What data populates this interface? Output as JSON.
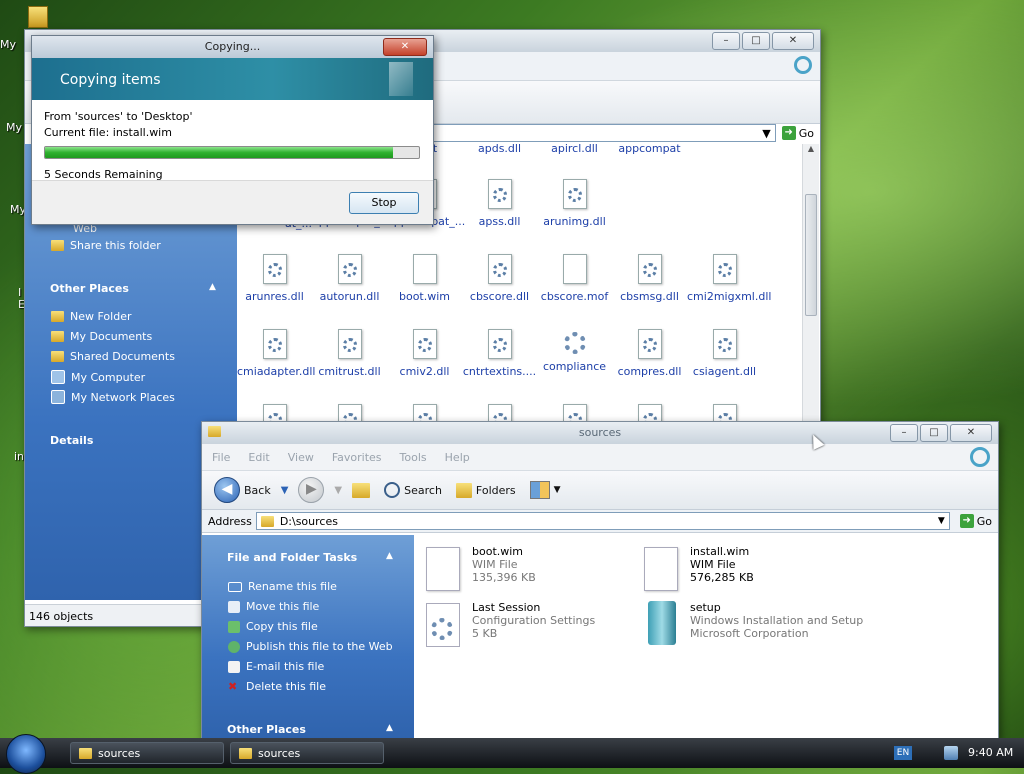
{
  "desktop": {
    "labels": [
      "My",
      "My",
      "My",
      "I",
      "E",
      "in"
    ]
  },
  "copy_dialog": {
    "title": "Copying...",
    "header": "Copying items",
    "from_text": "From 'sources' to 'Desktop'",
    "current_file": "Current file:  install.wim",
    "progress": 0.93,
    "remaining": "5 Seconds Remaining",
    "stop_label": "Stop"
  },
  "back_window": {
    "address_go": "Go",
    "address_tail": "s",
    "status": "146 objects",
    "sidebar": {
      "web_label": "Web",
      "share_label": "Share this folder",
      "other_places_title": "Other Places",
      "other_places": [
        "New Folder",
        "My Documents",
        "Shared Documents",
        "My Computer",
        "My Network Places"
      ],
      "details_title": "Details"
    },
    "top_partial": [
      "...",
      "alert",
      "apds.dll",
      "apircl.dll",
      "appcompat"
    ],
    "files": [
      [
        "appcompat_...",
        "appcompat_...",
        "apss.dll",
        "arunimg.dll"
      ],
      [
        "arunres.dll",
        "autorun.dll",
        "boot.wim",
        "cbscore.dll",
        "cbscore.mof",
        "cbsmsg.dll",
        "cmi2migxml.dll"
      ],
      [
        "cmiadapter.dll",
        "cmitrust.dll",
        "cmiv2.dll",
        "cntrtextins....",
        "compliance",
        "compres.dll",
        "csiagent.dll"
      ]
    ],
    "row1_partial": "at_..."
  },
  "front_window": {
    "title": "sources",
    "menu": [
      "File",
      "Edit",
      "View",
      "Favorites",
      "Tools",
      "Help"
    ],
    "toolbar": {
      "back": "Back",
      "search": "Search",
      "folders": "Folders"
    },
    "address_label": "Address",
    "address_value": "D:\\sources",
    "go": "Go",
    "tasks_title": "File and Folder Tasks",
    "tasks": [
      "Rename this file",
      "Move this file",
      "Copy this file",
      "Publish this file to the Web",
      "E-mail this file",
      "Delete this file"
    ],
    "other_places_title": "Other Places",
    "items": [
      {
        "name": "boot.wim",
        "line2": "WIM File",
        "line3": "135,396 KB"
      },
      {
        "name": "install.wim",
        "line2": "WIM File",
        "line3": "576,285 KB"
      },
      {
        "name": "Last Session",
        "line2": "Configuration Settings",
        "line3": "5 KB"
      },
      {
        "name": "setup",
        "line2": "Windows Installation and Setup",
        "line3": "Microsoft Corporation"
      }
    ]
  },
  "taskbar": {
    "buttons": [
      "sources",
      "sources"
    ],
    "lang": "EN",
    "time": "9:40 AM"
  }
}
